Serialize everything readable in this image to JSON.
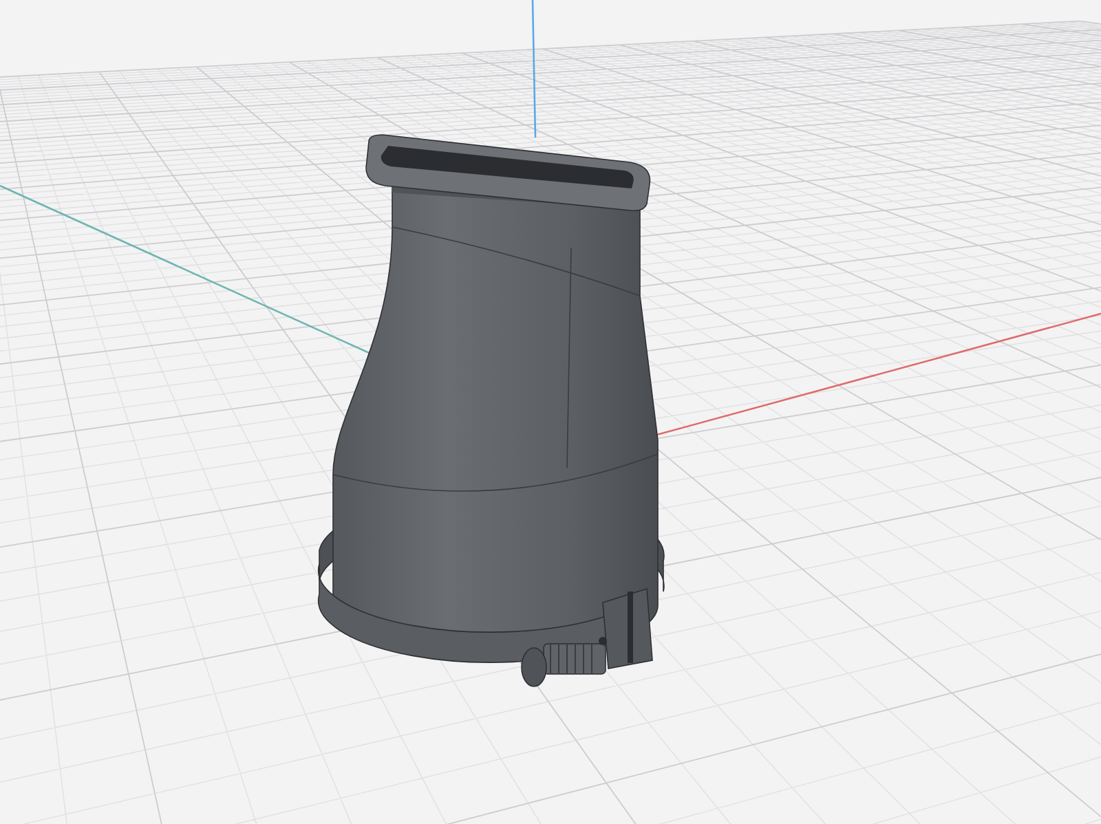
{
  "viewport": {
    "axes": [
      {
        "kind": "x",
        "color": "#e06a6a"
      },
      {
        "kind": "y",
        "color": "#6fb5b0"
      },
      {
        "kind": "z",
        "color": "#5aa8e8"
      }
    ]
  }
}
